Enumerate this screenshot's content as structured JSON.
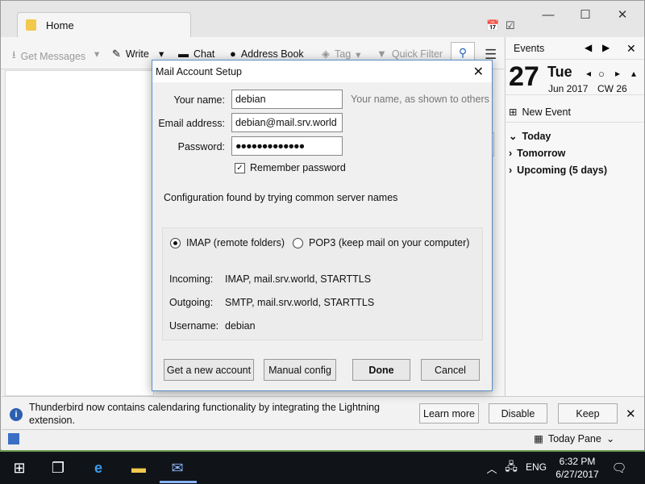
{
  "window": {
    "tab_home": "Home"
  },
  "toolbar": {
    "get_messages": "Get Messages",
    "write": "Write",
    "chat": "Chat",
    "address_book": "Address Book",
    "tag": "Tag",
    "quick_filter": "Quick Filter"
  },
  "events": {
    "header": "Events",
    "day": "27",
    "weekday": "Tue",
    "month_year": "Jun 2017",
    "cw": "CW 26",
    "new_event": "New Event",
    "sections": [
      "Today",
      "Tomorrow",
      "Upcoming (5 days)"
    ]
  },
  "dialog": {
    "title": "Mail Account Setup",
    "name_label": "Your name:",
    "name_value": "debian",
    "name_hint": "Your name, as shown to others",
    "email_label": "Email address:",
    "email_value": "debian@mail.srv.world",
    "password_label": "Password:",
    "password_value": "●●●●●●●●●●●●●",
    "remember_label": "Remember password",
    "config_msg": "Configuration found by trying common server names",
    "imap_label": "IMAP (remote folders)",
    "pop3_label": "POP3 (keep mail on your computer)",
    "incoming_label": "Incoming:",
    "incoming_value": "IMAP, mail.srv.world, STARTTLS",
    "outgoing_label": "Outgoing:",
    "outgoing_value": "SMTP, mail.srv.world, STARTTLS",
    "username_label": "Username:",
    "username_value": "debian",
    "btn_new_account": "Get a new account",
    "btn_manual": "Manual config",
    "btn_done": "Done",
    "btn_cancel": "Cancel"
  },
  "notification": {
    "text": "Thunderbird now contains calendaring functionality by integrating the Lightning extension.",
    "learn_more": "Learn more",
    "disable": "Disable",
    "keep": "Keep"
  },
  "statusbar": {
    "today_pane": "Today Pane"
  },
  "taskbar": {
    "lang": "ENG",
    "time": "6:32 PM",
    "date": "6/27/2017"
  }
}
